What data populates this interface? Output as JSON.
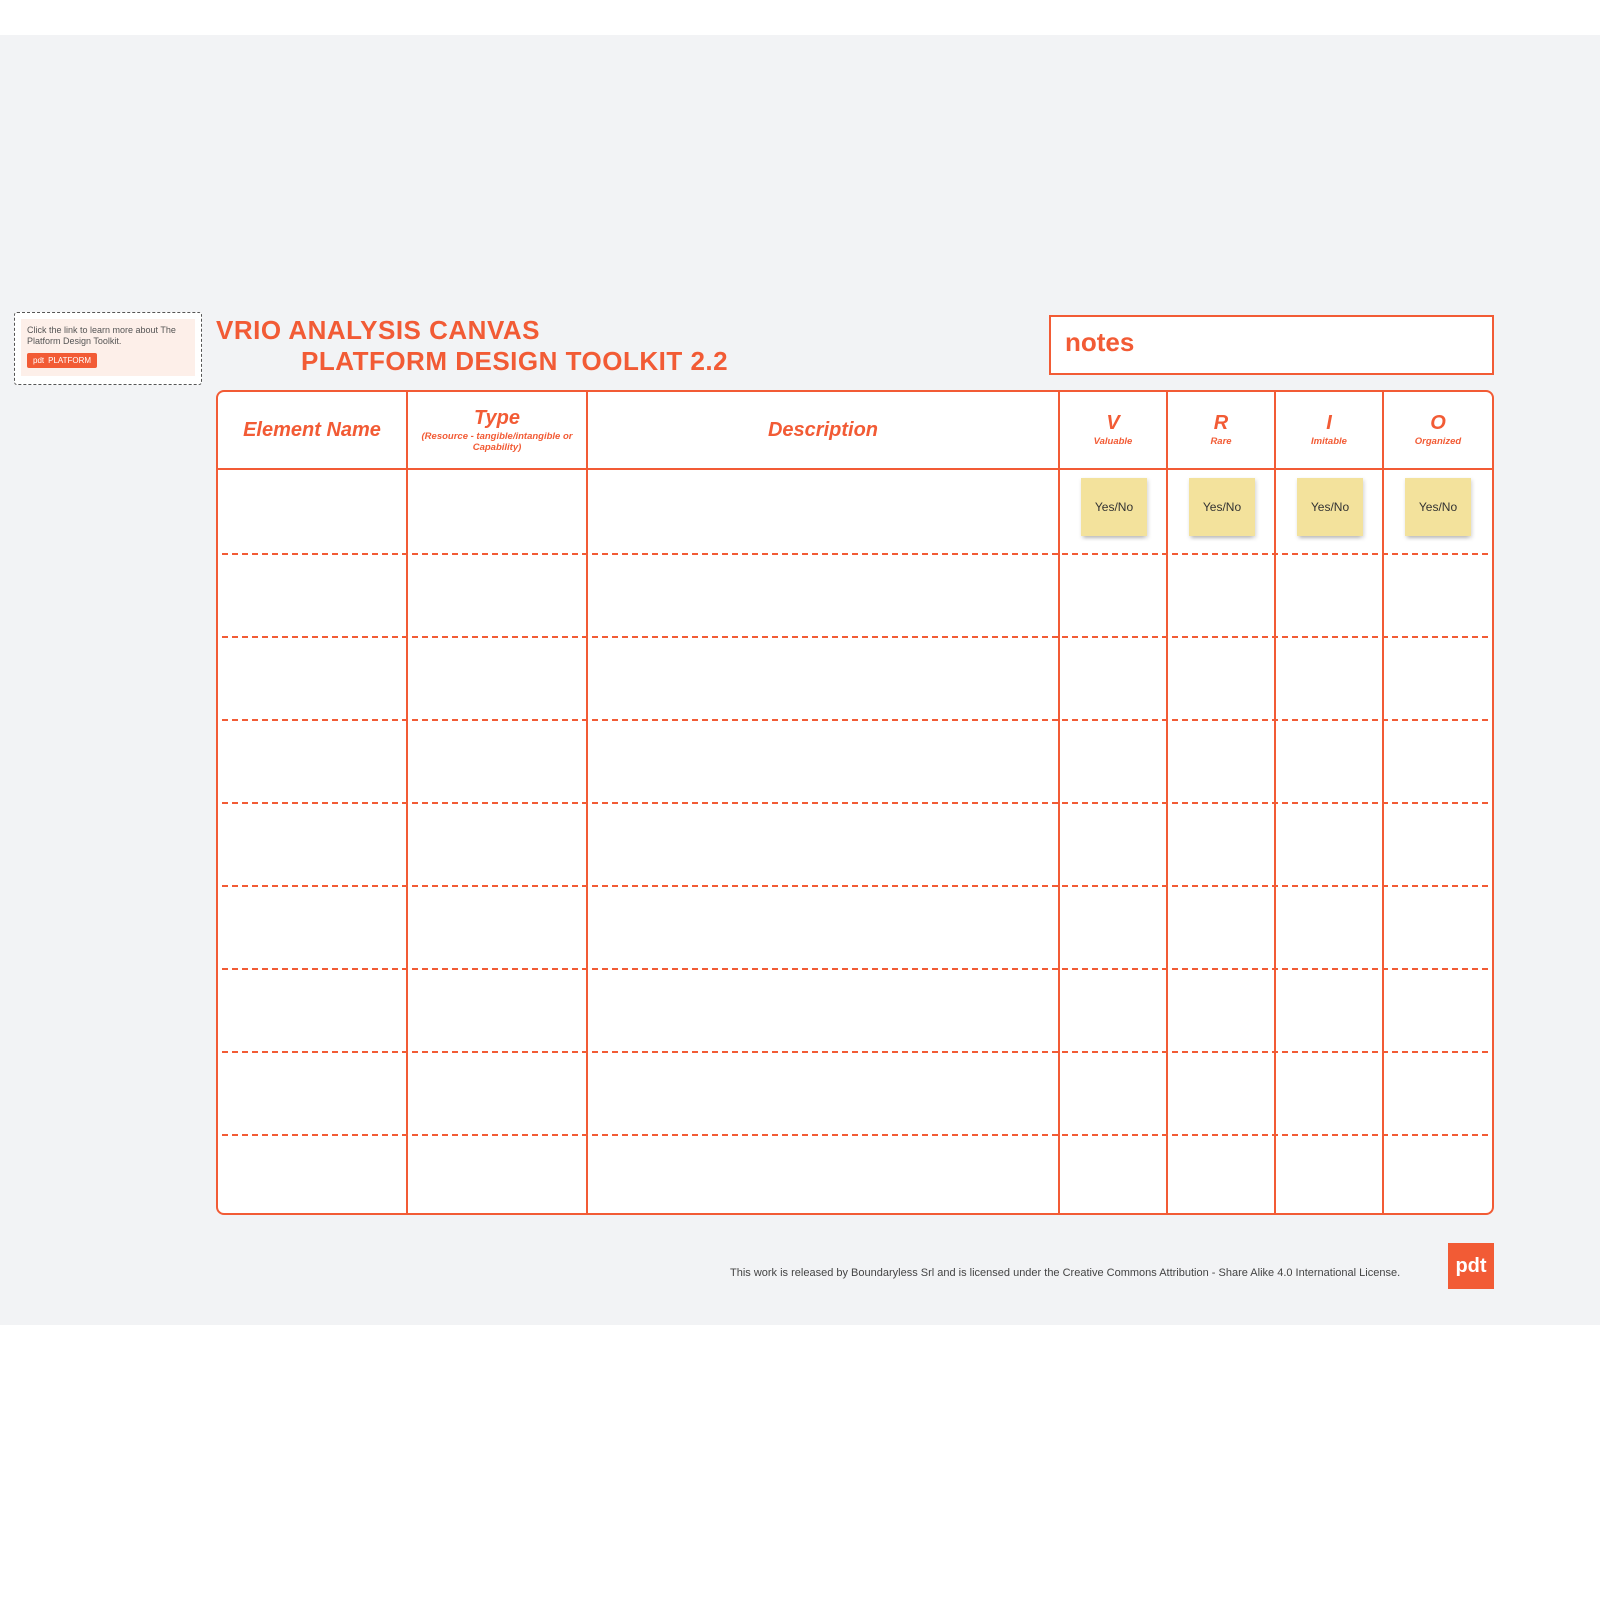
{
  "learn": {
    "text": "Click the link to learn more about The Platform Design Toolkit.",
    "badge_icon": "pdt",
    "badge_text": "PLATFORM"
  },
  "title": {
    "line1": "VRIO ANALYSIS CANVAS",
    "line2": "PLATFORM DESIGN TOOLKIT 2.2"
  },
  "notes_label": "notes",
  "columns": {
    "name": {
      "label": "Element Name"
    },
    "type": {
      "label": "Type",
      "sub": "(Resource - tangible/intangible or Capability)"
    },
    "desc": {
      "label": "Description"
    },
    "v": {
      "label": "V",
      "sub": "Valuable"
    },
    "r": {
      "label": "R",
      "sub": "Rare"
    },
    "i": {
      "label": "I",
      "sub": "Imitable"
    },
    "o": {
      "label": "O",
      "sub": "Organized"
    }
  },
  "row_count": 9,
  "sticky": {
    "v": "Yes/No",
    "r": "Yes/No",
    "i": "Yes/No",
    "o": "Yes/No"
  },
  "footer": {
    "text": "This work is released by Boundaryless Srl and is licensed under the Creative Commons Attribution - Share Alike 4.0 International License.",
    "badge": "pdt"
  }
}
